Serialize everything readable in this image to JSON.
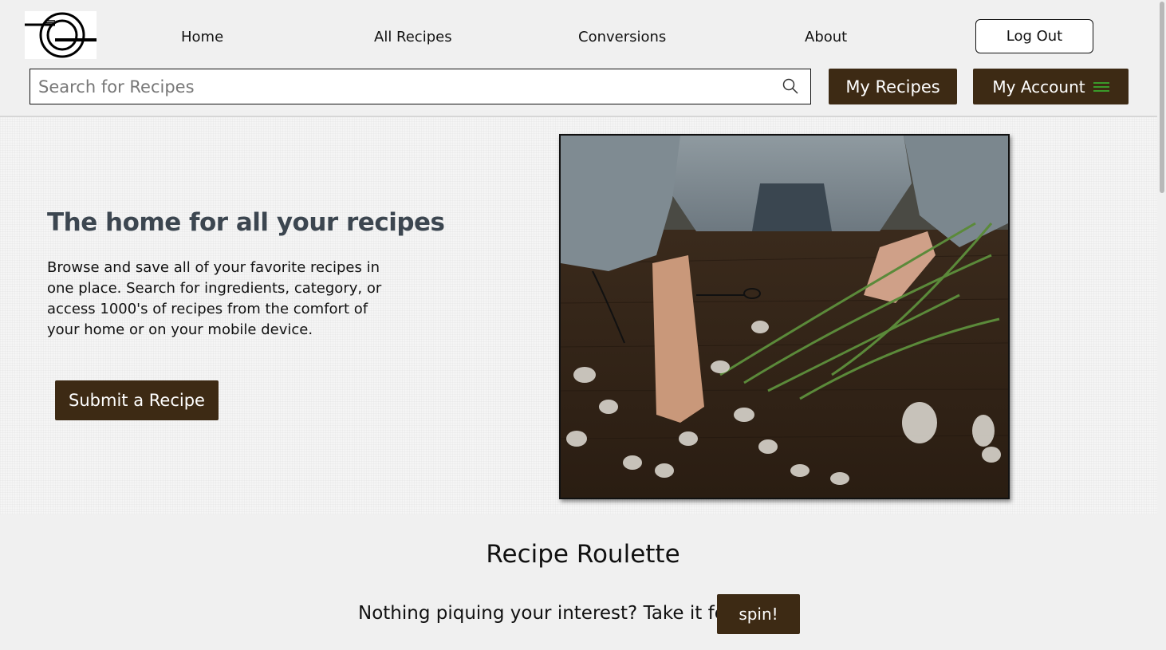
{
  "nav": {
    "items": [
      "Home",
      "All Recipes",
      "Conversions",
      "About"
    ],
    "logout_label": "Log Out"
  },
  "search": {
    "placeholder": "Search for Recipes",
    "value": ""
  },
  "header_buttons": {
    "my_recipes": "My Recipes",
    "my_account": "My Account"
  },
  "hero": {
    "title": "The home for all your recipes",
    "body": "Browse and save all of your favorite recipes in one place. Search for ingredients, category, or access 1000's of recipes from the comfort of your home or on your mobile device.",
    "submit_label": "Submit a Recipe"
  },
  "roulette": {
    "title": "Recipe Roulette",
    "prompt": "Nothing piquing your interest? Take it for a",
    "spin_label": "spin!"
  },
  "icons": {
    "logo": "plate-and-cutlery-logo",
    "search": "search-icon",
    "menu": "hamburger-menu-icon"
  },
  "colors": {
    "brand_dark": "#3d2a14",
    "menu_icon_green": "#3a9a2a",
    "heading": "#3c4650",
    "background": "#f0f0f0"
  }
}
